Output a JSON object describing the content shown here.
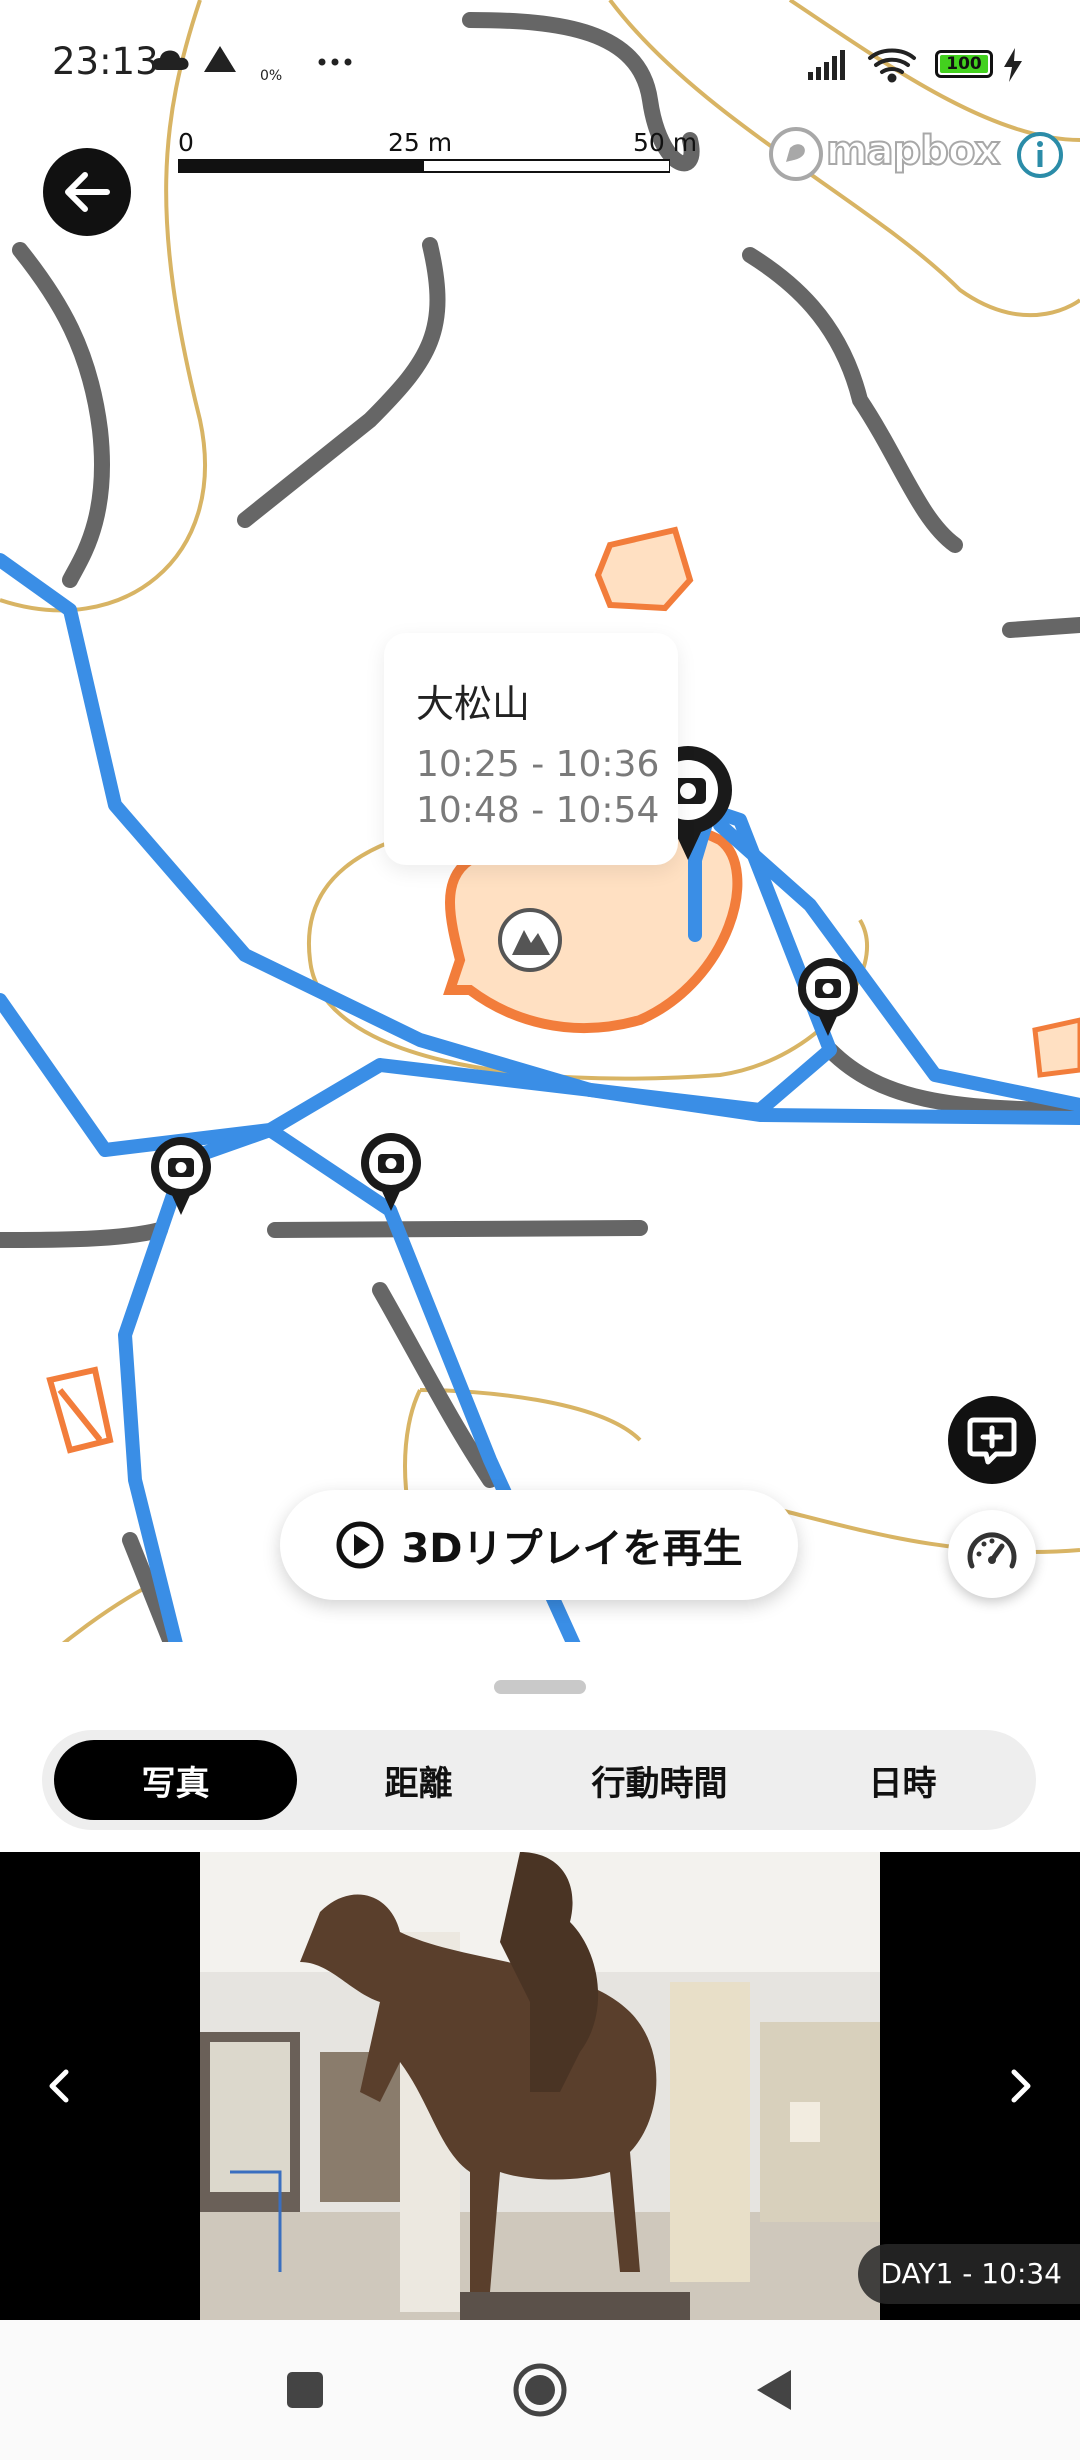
{
  "status_bar": {
    "time": "23:13",
    "moon_percent": "0%",
    "battery_level": "100",
    "battery_fill_fraction": 1.0
  },
  "map": {
    "scale_labels": [
      "0",
      "25 m",
      "50 m"
    ],
    "attribution": "mapbox",
    "summit_popup": {
      "name": "大松山",
      "times": [
        "10:25 - 10:36",
        "10:48 - 10:54"
      ]
    },
    "route_color": "#3a8ee6",
    "contour_color": "#d8b464",
    "trail_color": "#666666",
    "summit_area_color": "#ffe0c2",
    "summit_border_color": "#f27d3b",
    "photo_pin_count": 5
  },
  "replay_button": {
    "label": "3Dリプレイを再生",
    "icon": "play-circle-icon"
  },
  "bottom_sheet": {
    "tabs": [
      {
        "label": "写真",
        "active": true
      },
      {
        "label": "距離",
        "active": false
      },
      {
        "label": "行動時間",
        "active": false
      },
      {
        "label": "日時",
        "active": false
      }
    ],
    "photo": {
      "caption": "DAY1 - 10:34"
    }
  },
  "icons": {
    "back": "arrow-left-icon",
    "info": "info-icon",
    "add_comment": "add-comment-icon",
    "speed": "speedometer-icon",
    "nav_recents": "square-icon",
    "nav_home": "circle-icon",
    "nav_back": "triangle-back-icon"
  }
}
